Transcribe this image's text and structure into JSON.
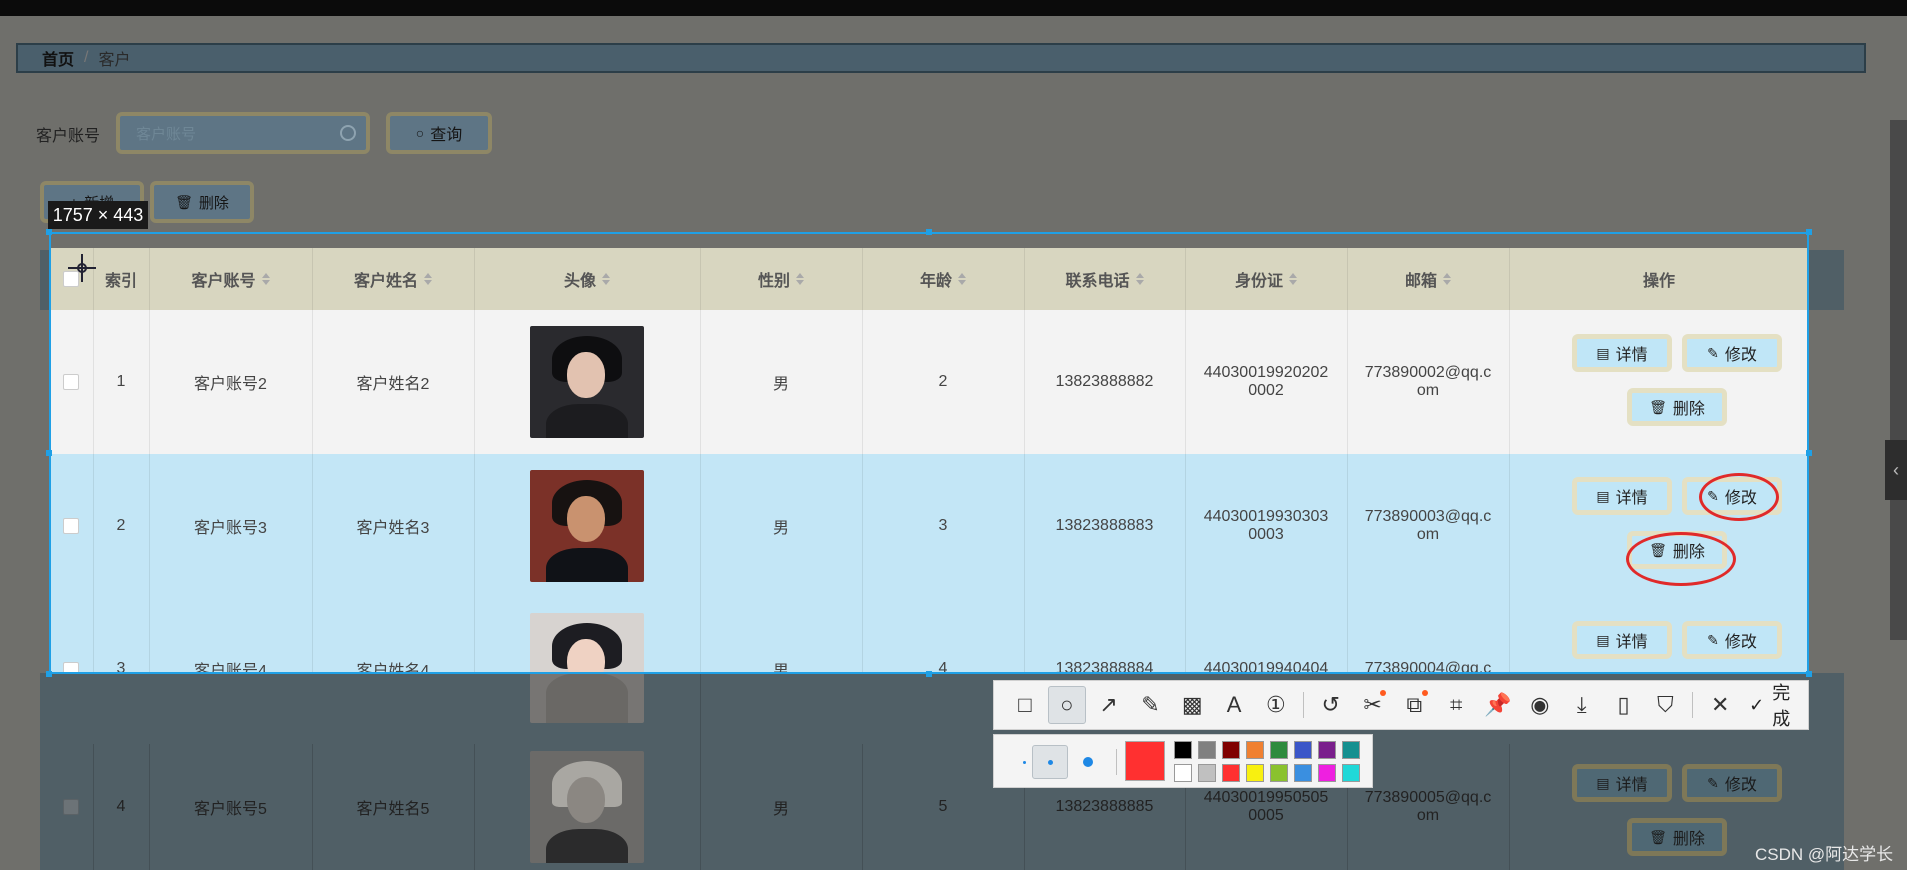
{
  "breadcrumb": {
    "home": "首页",
    "separator": "/",
    "current": "客户"
  },
  "search": {
    "label": "客户账号",
    "placeholder": "客户账号",
    "query_button": "查询"
  },
  "toolbar_buttons": {
    "add": "新增",
    "delete": "删除"
  },
  "selection": {
    "size_label": "1757 × 443"
  },
  "table": {
    "headers": [
      "索引",
      "客户账号",
      "客户姓名",
      "头像",
      "性别",
      "年龄",
      "联系电话",
      "身份证",
      "邮箱",
      "操作"
    ],
    "rows": [
      {
        "index": "1",
        "account": "客户账号2",
        "name": "客户姓名2",
        "gender": "男",
        "age": "2",
        "phone": "13823888882",
        "id_line1": "44030019920202",
        "id_line2": "0002",
        "email_line1": "773890002@qq.c",
        "email_line2": "om"
      },
      {
        "index": "2",
        "account": "客户账号3",
        "name": "客户姓名3",
        "gender": "男",
        "age": "3",
        "phone": "13823888883",
        "id_line1": "44030019930303",
        "id_line2": "0003",
        "email_line1": "773890003@qq.c",
        "email_line2": "om"
      },
      {
        "index": "3",
        "account": "客户账号4",
        "name": "客户姓名4",
        "gender": "男",
        "age": "4",
        "phone": "13823888884",
        "id_line1": "44030019940404",
        "id_line2": "",
        "email_line1": "773890004@qq.c",
        "email_line2": ""
      },
      {
        "index": "4",
        "account": "客户账号5",
        "name": "客户姓名5",
        "gender": "男",
        "age": "5",
        "phone": "13823888885",
        "id_line1": "44030019950505",
        "id_line2": "0005",
        "email_line1": "773890005@qq.c",
        "email_line2": "om"
      }
    ],
    "actions": {
      "detail": "详情",
      "edit": "修改",
      "delete": "删除"
    }
  },
  "annotation_toolbar": {
    "tools": [
      "rectangle-icon",
      "ellipse-icon",
      "arrow-icon",
      "pencil-icon",
      "mosaic-icon",
      "text-icon",
      "number-icon",
      "undo-icon",
      "cut-icon",
      "translate-icon",
      "ocr-icon",
      "pin-icon",
      "record-icon",
      "download-icon",
      "long-screenshot-icon",
      "bookmark-icon",
      "close-icon"
    ],
    "done_label": "完成",
    "current_color": "#ff3030",
    "palette_row1": [
      "#000000",
      "#808080",
      "#800000",
      "#f08030",
      "#2e8b3e",
      "#3a56c8",
      "#7a1f8c",
      "#159090"
    ],
    "palette_row2": [
      "#ffffff",
      "#c0c0c0",
      "#ff3030",
      "#f8f010",
      "#8ac22e",
      "#3a8fe0",
      "#ee20e0",
      "#20d8d8"
    ]
  },
  "watermark": "CSDN @阿达学长"
}
